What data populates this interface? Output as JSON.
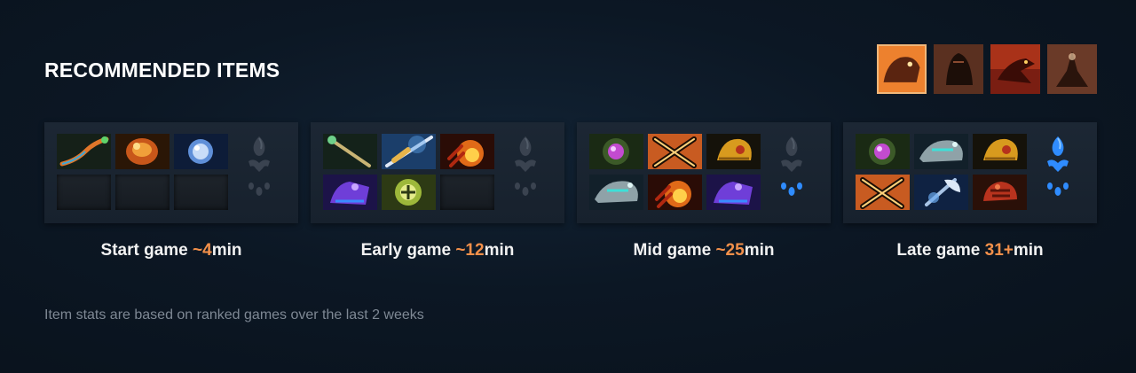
{
  "header": {
    "title": "RECOMMENDED ITEMS"
  },
  "abilities": [
    {
      "icon": "ability-beast-charge-icon",
      "active": true,
      "color": "#e8891f"
    },
    {
      "icon": "ability-shadow-roar-icon",
      "active": false,
      "color": "#4a2618"
    },
    {
      "icon": "ability-dragon-breath-icon",
      "active": false,
      "color": "#a6331c"
    },
    {
      "icon": "ability-dark-summon-icon",
      "active": false,
      "color": "#5a3224"
    }
  ],
  "phases": [
    {
      "label": "Start game ",
      "time_prefix": "~",
      "time_value": "4",
      "unit": "min",
      "items": [
        "orange-staff-item-icon",
        "orange-stone-item-icon",
        "blue-orb-item-icon",
        "",
        "",
        ""
      ],
      "aghanim_shard": false,
      "aghanim_scepter": false
    },
    {
      "label": "Early game ",
      "time_prefix": "~",
      "time_value": "12",
      "unit": "min",
      "items": [
        "green-wand-item-icon",
        "blue-lance-item-icon",
        "fire-claw-item-icon",
        "purple-boots-item-icon",
        "green-rune-item-icon",
        ""
      ],
      "aghanim_shard": false,
      "aghanim_scepter": false
    },
    {
      "label": "Mid game ",
      "time_prefix": "~",
      "time_value": "25",
      "unit": "min",
      "items": [
        "pink-orb-item-icon",
        "crossed-swords-item-icon",
        "golden-mask-item-icon",
        "silver-helm-item-icon",
        "fire-claw-item-icon",
        "purple-boots-item-icon"
      ],
      "aghanim_shard": false,
      "aghanim_scepter": true
    },
    {
      "label": "Late game ",
      "time_prefix": "",
      "time_value": "31+",
      "unit": "min",
      "items": [
        "pink-orb-item-icon",
        "silver-helm-item-icon",
        "golden-mask-item-icon",
        "crossed-swords-item-icon",
        "frost-axe-item-icon",
        "red-gauntlet-item-icon"
      ],
      "aghanim_shard": true,
      "aghanim_scepter": true
    }
  ],
  "colors": {
    "accent": "#f3904a",
    "active_border": "#f0b77a",
    "aghanim_active": "#2f8cff",
    "aghanim_inactive": "#3a4350"
  },
  "footnote": "Item stats are based on ranked games over the last 2 weeks"
}
